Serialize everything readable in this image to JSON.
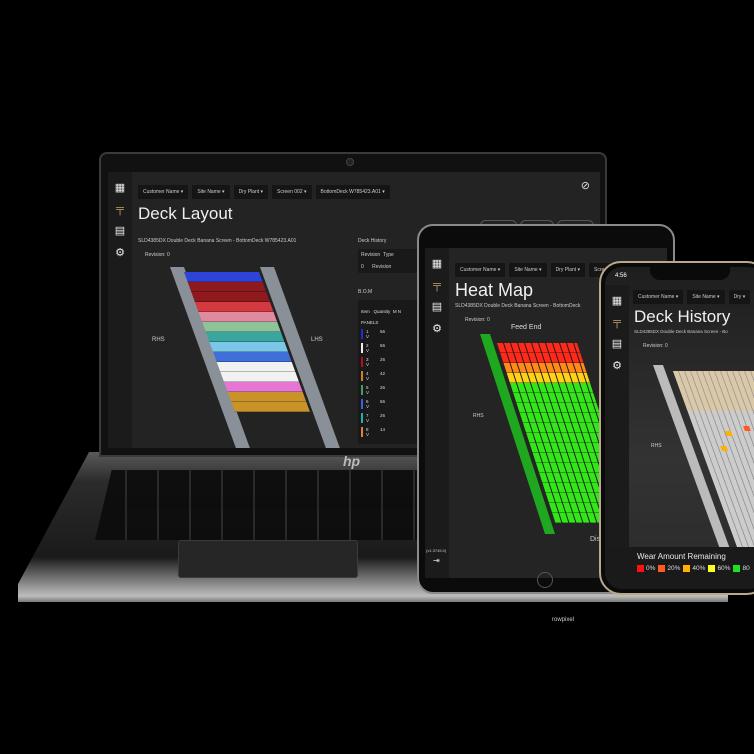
{
  "laptop": {
    "brand": "hp",
    "nav_icons": [
      "grid-icon",
      "deck-icon",
      "document-icon",
      "gear-icon"
    ],
    "dropdowns": [
      "Customer Name",
      "Site Name",
      "Dry Plant",
      "Screen 002",
      "BottomDeck W785423.A01"
    ],
    "title": "Deck Layout",
    "tabs": [
      "HEAT MAP",
      "HISTORY",
      "DIALOGUE"
    ],
    "subtitle": "SLD4385DX Double Deck Banana Screen - BottomDeck W785423.A01",
    "revision": "Revision: 0",
    "rhs": "RHS",
    "lhs": "LHS",
    "deck_colors": [
      "#2f44d6",
      "#8e1a1e",
      "#8e1a1e",
      "#d23a3f",
      "#e08aa0",
      "#8cc49a",
      "#3aa59e",
      "#7bc7e8",
      "#3f6fd8",
      "#f2f2f2",
      "#f2f2f2",
      "#e775d4",
      "#c9932a",
      "#c9932a"
    ],
    "history": {
      "title": "Deck History",
      "headers": [
        "Revision",
        "Type"
      ],
      "rows": [
        [
          "0",
          "Revision"
        ]
      ]
    },
    "bom": {
      "title": "B.O.M",
      "headers": [
        "Item",
        "Quantity",
        "M N"
      ],
      "group": "PANELS",
      "rows": [
        [
          "1",
          "56",
          "V"
        ],
        [
          "2",
          "56",
          "V"
        ],
        [
          "3",
          "26",
          "V"
        ],
        [
          "4",
          "42",
          "V"
        ],
        [
          "5",
          "26",
          "V"
        ],
        [
          "6",
          "56",
          "V"
        ],
        [
          "7",
          "26",
          "V"
        ],
        [
          "8",
          "14",
          "V"
        ]
      ],
      "colors": [
        "#2030d0",
        "#eeeeee",
        "#b01020",
        "#d08020",
        "#40a060",
        "#4060e0",
        "#20b0b0",
        "#e08040"
      ]
    }
  },
  "tablet": {
    "dropdowns": [
      "Customer Name",
      "Site Name",
      "Dry Plant",
      "Screen 002"
    ],
    "title": "Heat Map",
    "subtitle": "SLD4385DX Double Deck Banana Screen - BottomDeck",
    "revision": "Revision: 0",
    "feed_end": "Feed End",
    "rhs": "RHS",
    "discharge": "Dis",
    "version": "(v1.3745.0)",
    "heat_rows": [
      "#ff2a1a",
      "#ff2a1a",
      "#ff8a1a",
      "#ffd21a",
      "#33e61a",
      "#33e61a",
      "#33e61a",
      "#33e61a",
      "#33e61a",
      "#33e61a",
      "#33e61a",
      "#33e61a",
      "#33e61a",
      "#33e61a",
      "#33e61a",
      "#33e61a",
      "#33e61a",
      "#33e61a"
    ]
  },
  "phone": {
    "time": "4:56",
    "dropdowns": [
      "Customer Name",
      "Site Name",
      "Dry"
    ],
    "title": "Deck History",
    "subtitle": "SLD4385DX Double Deck Banana Screen - Bo",
    "revision": "Revision: 0",
    "rhs": "RHS",
    "legend_title": "Wear Amount Remaining",
    "legend": [
      {
        "label": "0%",
        "color": "#ff1010"
      },
      {
        "label": "20%",
        "color": "#ff5a20"
      },
      {
        "label": "40%",
        "color": "#ffb000"
      },
      {
        "label": "60%",
        "color": "#ffff20"
      },
      {
        "label": "80",
        "color": "#20e020"
      }
    ]
  },
  "watermark": "rowpixel"
}
